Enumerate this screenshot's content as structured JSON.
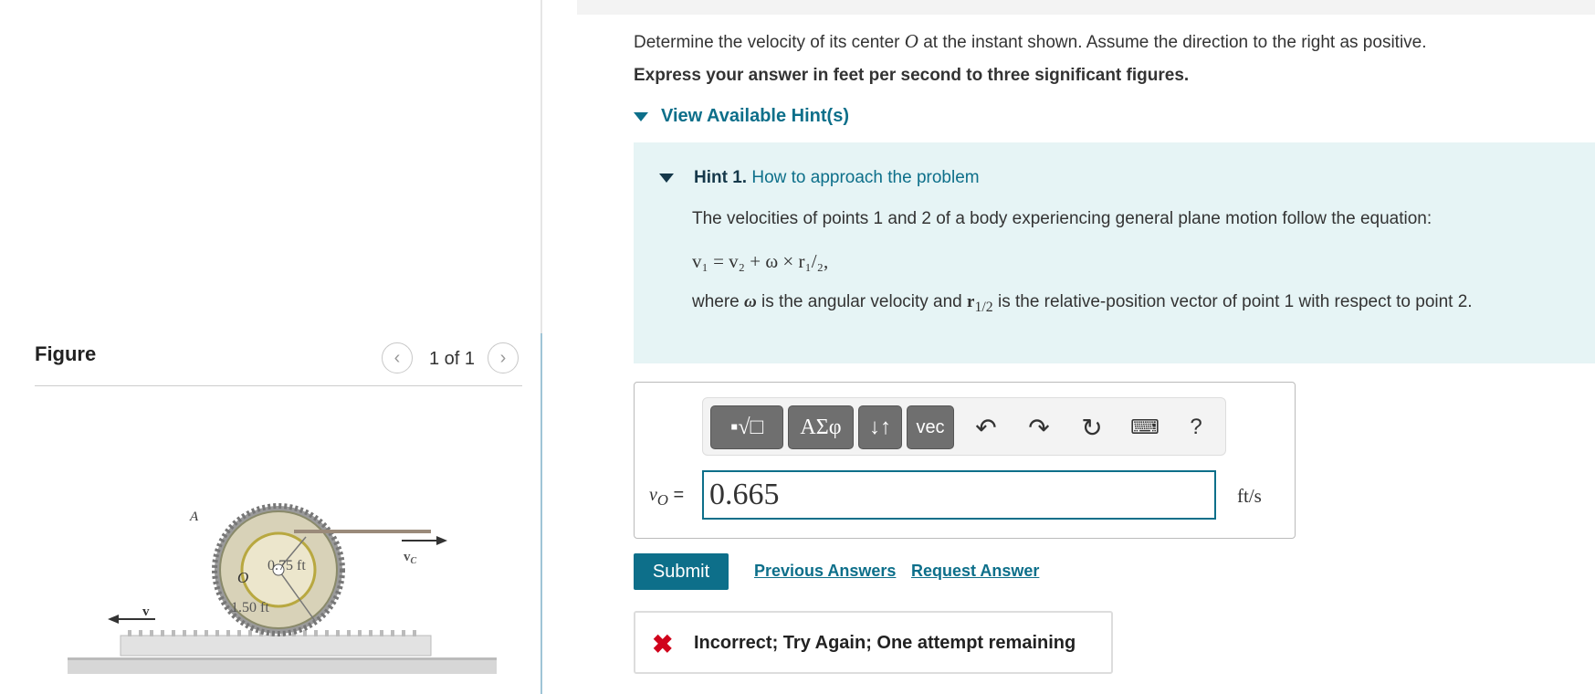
{
  "figure_panel": {
    "title": "Figure",
    "counter": "1 of 1",
    "figure_labels": {
      "point_a": "A",
      "point_o": "O",
      "inner_radius": "0.75 ft",
      "outer_radius": "1.50 ft",
      "velocity_v": "v",
      "velocity_vc": "v",
      "velocity_vc_sub": "C"
    }
  },
  "question": {
    "text_before": "Determine the velocity of its center ",
    "variable": "O",
    "text_after": " at the instant shown. Assume the direction to the right as positive.",
    "instruction": "Express your answer in feet per second to three significant figures."
  },
  "hints": {
    "toggle_label": "View Available Hint(s)",
    "hint1": {
      "number": "Hint 1.",
      "title": "How to approach the problem",
      "line1": "The velocities of points 1 and 2 of a body experiencing general plane motion follow the equation:",
      "equation": "v₁ = v₂ + ω × r₁/₂,",
      "line2_a": "where ",
      "line2_omega": "ω",
      "line2_b": " is the angular velocity and ",
      "line2_r": "r",
      "line2_rsub": "1/2",
      "line2_c": " is the relative-position vector of point 1 with respect to point 2."
    }
  },
  "answer": {
    "label_var": "v",
    "label_sub": "O",
    "label_eq": " =",
    "value": "0.665",
    "unit": "ft/s",
    "toolbar": {
      "templates": "▪√□",
      "greek": "ΑΣφ",
      "arrows": "↓↑",
      "vec": "vec",
      "help": "?"
    }
  },
  "actions": {
    "submit": "Submit",
    "previous_answers": "Previous Answers",
    "request_answer": "Request Answer"
  },
  "feedback": {
    "icon": "✖",
    "message": "Incorrect; Try Again; One attempt remaining"
  }
}
